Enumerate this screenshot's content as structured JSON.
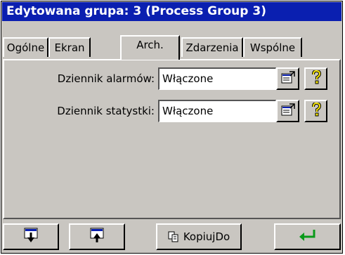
{
  "window": {
    "title": "Edytowana grupa: 3 (Process Group 3)"
  },
  "tabs": [
    {
      "label": "Ogólne",
      "active": false
    },
    {
      "label": "Ekran",
      "active": false
    },
    {
      "label": "Arch.",
      "active": true
    },
    {
      "label": "Zdarzenia",
      "active": false
    },
    {
      "label": "Wspólne",
      "active": false
    }
  ],
  "form": {
    "alarm_log": {
      "label": "Dziennik alarmów:",
      "value": "Włączone"
    },
    "stats_log": {
      "label": "Dziennik statystki:",
      "value": "Włączone"
    }
  },
  "toolbar": {
    "copy_label": "KopiujDo"
  },
  "icons": {
    "properties": "properties-icon",
    "help": "help-question-icon",
    "download": "download-icon",
    "upload": "upload-icon",
    "copy": "copy-icon",
    "enter": "enter-arrow-icon"
  },
  "colors": {
    "title_bg": "#0a1fb0",
    "panel_bg": "#c9c6c1",
    "help_yellow": "#f5e400",
    "enter_green": "#0a9a1a"
  }
}
